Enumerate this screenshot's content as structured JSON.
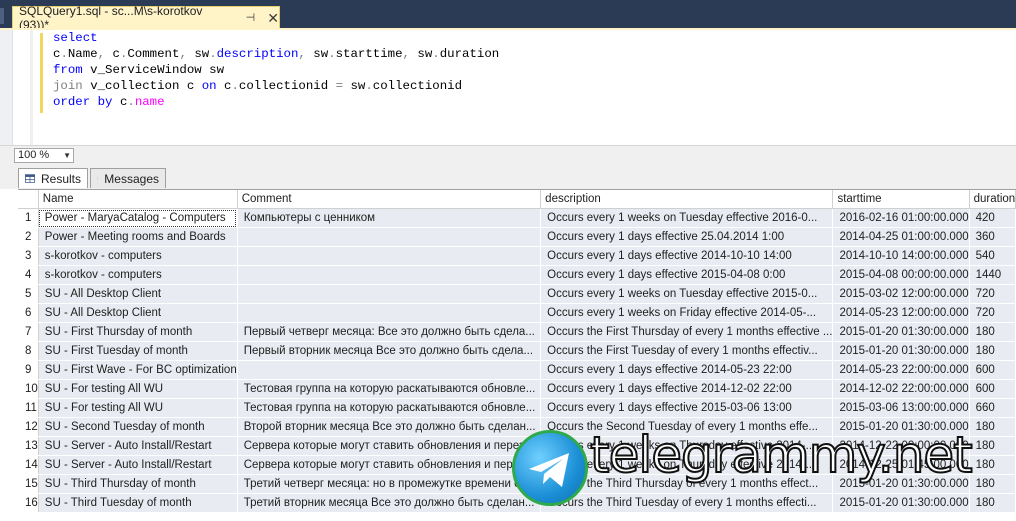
{
  "window": {
    "tab_title": "SQLQuery1.sql - sc...M\\s-korotkov (93))*",
    "pin_glyph": "⊣",
    "close_glyph": "✕"
  },
  "editor": {
    "lines": [
      "select",
      "c.Name, c.Comment, sw.description, sw.starttime, sw.duration",
      "from v_ServiceWindow sw",
      "join v_collection c on c.collectionid = sw.collectionid",
      "order by c.name"
    ]
  },
  "zoom": {
    "value": "100 %"
  },
  "result_tabs": {
    "results": "Results",
    "messages": "Messages"
  },
  "grid": {
    "columns": [
      "Name",
      "Comment",
      "description",
      "starttime",
      "duration"
    ],
    "rows": [
      [
        "1",
        "Power - MaryaCatalog - Computers",
        "Компьютеры с ценником",
        "Occurs every 1 weeks on Tuesday effective 2016-0...",
        "2016-02-16 01:00:00.000",
        "420"
      ],
      [
        "2",
        "Power - Meeting rooms and Boards",
        "",
        "Occurs every 1 days effective 25.04.2014 1:00",
        "2014-04-25 01:00:00.000",
        "360"
      ],
      [
        "3",
        "s-korotkov - computers",
        "",
        "Occurs every 1 days effective 2014-10-10 14:00",
        "2014-10-10 14:00:00.000",
        "540"
      ],
      [
        "4",
        "s-korotkov - computers",
        "",
        "Occurs every 1 days effective 2015-04-08 0:00",
        "2015-04-08 00:00:00.000",
        "1440"
      ],
      [
        "5",
        "SU - All Desktop Client",
        "",
        "Occurs every 1 weeks on Tuesday effective 2015-0...",
        "2015-03-02 12:00:00.000",
        "720"
      ],
      [
        "6",
        "SU - All Desktop Client",
        "",
        "Occurs every 1 weeks on Friday effective 2014-05-...",
        "2014-05-23 12:00:00.000",
        "720"
      ],
      [
        "7",
        "SU - First Thursday of month",
        "Первый четверг месяца:  Все это должно быть сдела...",
        "Occurs the First Thursday of every 1 months effective ...",
        "2015-01-20 01:30:00.000",
        "180"
      ],
      [
        "8",
        "SU - First Tuesday of month",
        "Первый вторник месяца  Все это должно быть сдела...",
        "Occurs the First Tuesday of every 1 months effectiv...",
        "2015-01-20 01:30:00.000",
        "180"
      ],
      [
        "9",
        "SU - First Wave - For BC optimization",
        "",
        "Occurs every 1 days effective 2014-05-23 22:00",
        "2014-05-23 22:00:00.000",
        "600"
      ],
      [
        "10",
        "SU - For testing All WU",
        "Тестовая группа на которую раскатываются обновле...",
        "Occurs every 1 days effective 2014-12-02 22:00",
        "2014-12-02 22:00:00.000",
        "600"
      ],
      [
        "11",
        "SU - For testing All WU",
        "Тестовая группа на которую раскатываются обновле...",
        "Occurs every 1 days effective 2015-03-06 13:00",
        "2015-03-06 13:00:00.000",
        "660"
      ],
      [
        "12",
        "SU - Second Tuesday of month",
        "Второй вторник  месяца  Все это должно быть сделан...",
        "Occurs the Second Tuesday of every 1 months effe...",
        "2015-01-20 01:30:00.000",
        "180"
      ],
      [
        "13",
        "SU - Server - Auto Install/Restart",
        "Сервера которые могут ставить обновления и переза...",
        "Occurs every 1 weeks on Thursday effective 2014-...",
        "2014-12-22 00:00:00.000",
        "180"
      ],
      [
        "14",
        "SU - Server - Auto Install/Restart",
        "Сервера которые могут ставить обновления и переза...",
        "Occurs every 1 weeks on Thursday effective 2014-...",
        "2014-12-25 01:45:00.000",
        "180"
      ],
      [
        "15",
        "SU - Third Thursday of month",
        "Третий четверг месяца:  но в промежутке времени с...",
        "Occurs the Third Thursday of every 1 months effect...",
        "2015-01-20 01:30:00.000",
        "180"
      ],
      [
        "16",
        "SU - Third Tuesday of month",
        "Третий вторник месяца  Все это должно быть сделан...",
        "Occurs the Third Tuesday of every 1 months effecti...",
        "2015-01-20 01:30:00.000",
        "180"
      ]
    ]
  },
  "watermark": {
    "text": "telegrammy.net"
  }
}
